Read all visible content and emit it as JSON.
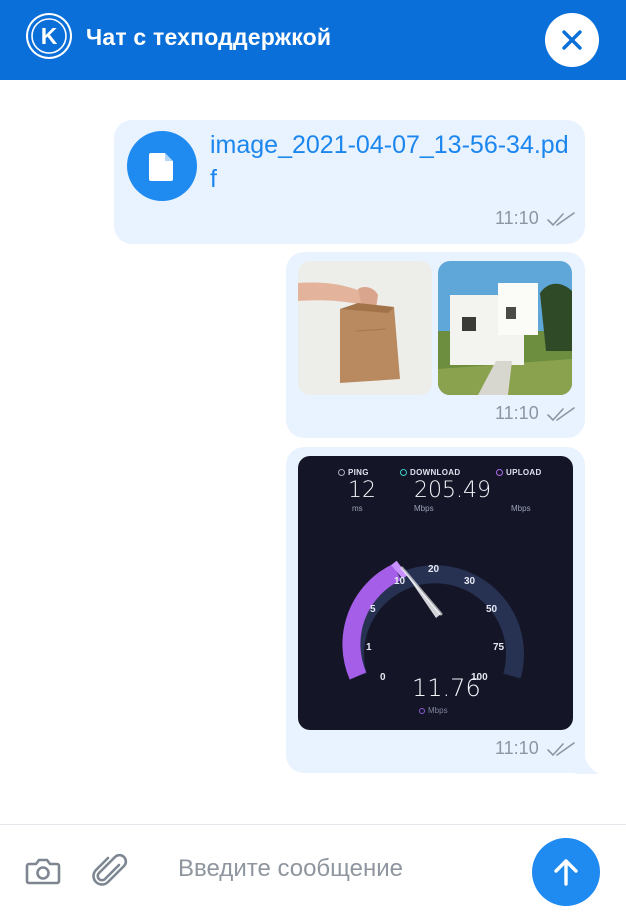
{
  "header": {
    "logo_letter": "K",
    "title": "Чат с техподдержкой",
    "close_icon": "close-icon",
    "color": "#0b6fd9"
  },
  "messages": [
    {
      "type": "file",
      "file_name": "image_2021-04-07_13-56-34.pdf",
      "icon": "document-icon",
      "time": "11:10",
      "status": "read"
    },
    {
      "type": "images",
      "images": [
        "paper-bag-photo",
        "white-house-photo"
      ],
      "time": "11:10",
      "status": "read"
    },
    {
      "type": "image",
      "time": "11:10",
      "status": "read",
      "speedtest": {
        "ping_label": "PING",
        "ping_value": "12",
        "ping_unit": "ms",
        "download_label": "DOWNLOAD",
        "download_value": "205.49",
        "download_unit": "Mbps",
        "upload_label": "UPLOAD",
        "upload_unit": "Mbps",
        "gauge_ticks": [
          "0",
          "1",
          "5",
          "10",
          "20",
          "30",
          "50",
          "75",
          "100"
        ],
        "current_reading": "11.76",
        "current_unit": "Mbps"
      }
    }
  ],
  "composer": {
    "camera_icon": "camera-icon",
    "attach_icon": "paperclip-icon",
    "placeholder": "Введите сообщение",
    "send_icon": "arrow-up-icon"
  },
  "colors": {
    "bubble": "#e9f3ff",
    "accent": "#1f8af0",
    "link": "#1c86ef",
    "meta": "#8c96a3"
  }
}
